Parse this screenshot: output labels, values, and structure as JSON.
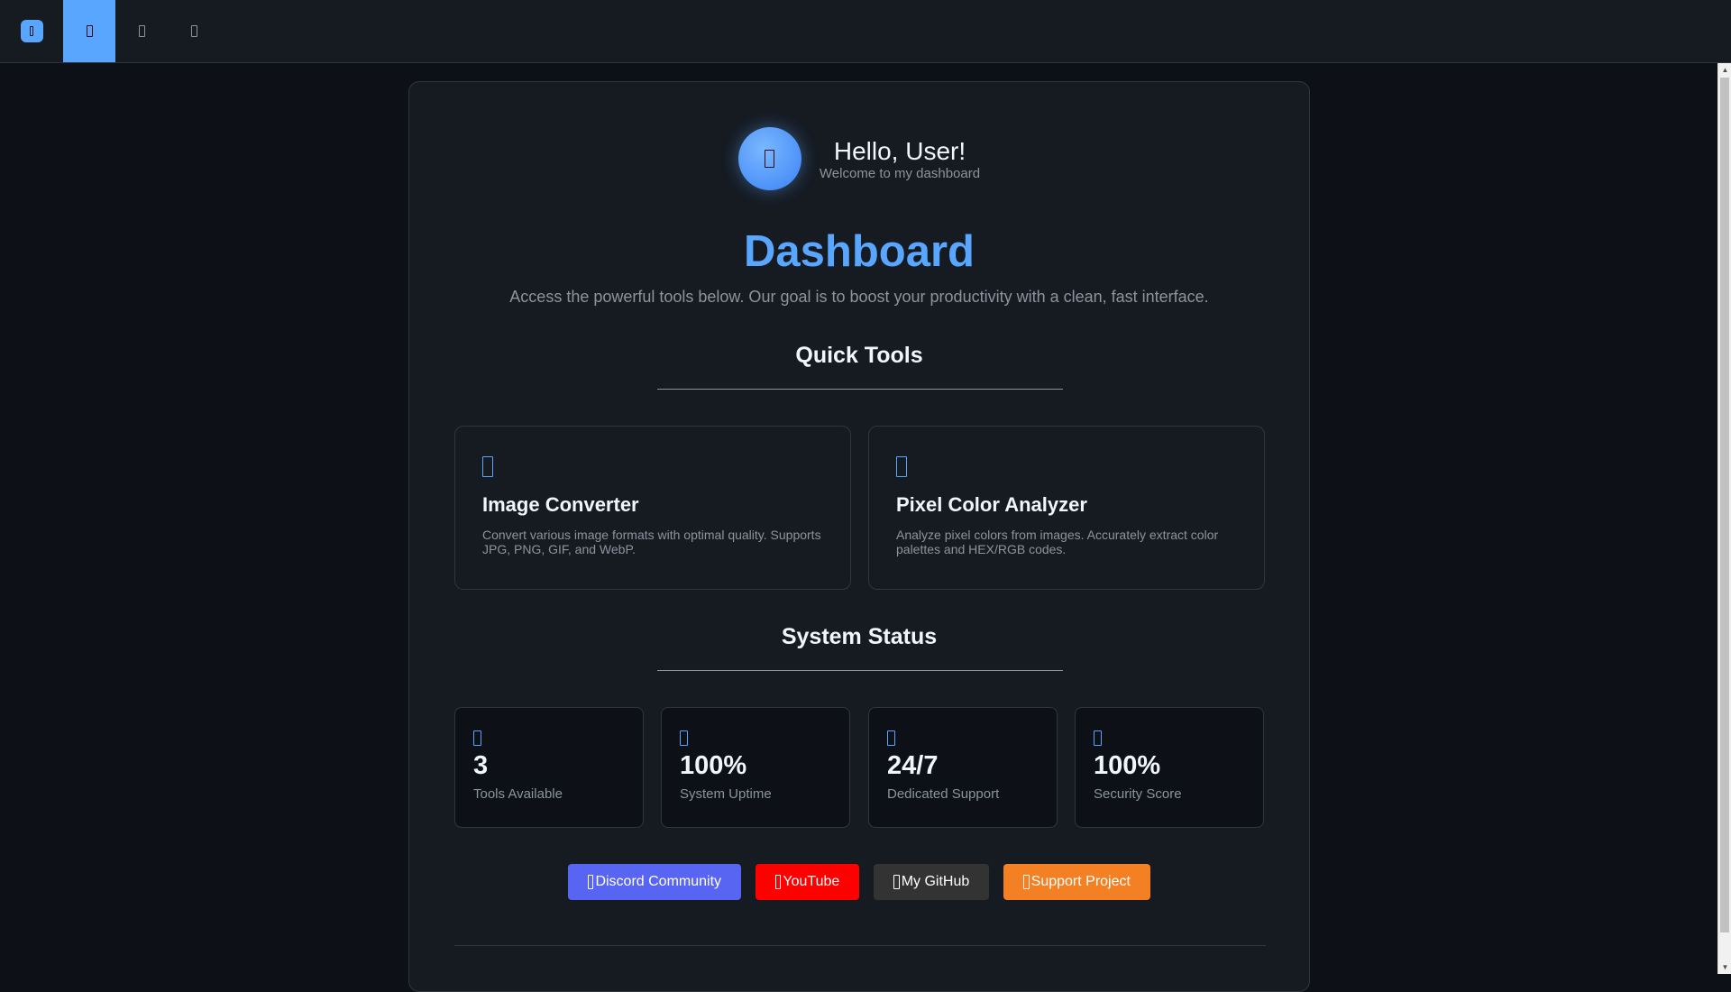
{
  "topbar": {
    "logo_icon": "app-logo-icon",
    "nav": [
      {
        "icon": "home-icon",
        "active": true
      },
      {
        "icon": "tools-icon",
        "active": false
      },
      {
        "icon": "info-icon",
        "active": false
      }
    ]
  },
  "greeting": {
    "avatar_icon": "user-icon",
    "title": "Hello, User!",
    "subtitle": "Welcome to my dashboard"
  },
  "dashboard": {
    "title": "Dashboard",
    "description": "Access the powerful tools below. Our goal is to boost your productivity with a clean, fast interface."
  },
  "quick_tools": {
    "title": "Quick Tools",
    "items": [
      {
        "icon": "image-icon",
        "title": "Image Converter",
        "description": "Convert various image formats with optimal quality. Supports JPG, PNG, GIF, and WebP."
      },
      {
        "icon": "eyedropper-icon",
        "title": "Pixel Color Analyzer",
        "description": "Analyze pixel colors from images. Accurately extract color palettes and HEX/RGB codes."
      }
    ]
  },
  "system_status": {
    "title": "System Status",
    "items": [
      {
        "icon": "toolbox-icon",
        "value": "3",
        "label": "Tools Available"
      },
      {
        "icon": "server-icon",
        "value": "100%",
        "label": "System Uptime"
      },
      {
        "icon": "headset-icon",
        "value": "24/7",
        "label": "Dedicated Support"
      },
      {
        "icon": "shield-icon",
        "value": "100%",
        "label": "Security Score"
      }
    ]
  },
  "links": [
    {
      "label": "Discord Community",
      "color": "#5865f2",
      "icon": "discord-icon"
    },
    {
      "label": "YouTube",
      "color": "#ff0000",
      "icon": "youtube-icon"
    },
    {
      "label": "My GitHub",
      "color": "#333333",
      "icon": "github-icon"
    },
    {
      "label": "Support Project",
      "color": "#f48024",
      "icon": "heart-icon"
    }
  ],
  "colors": {
    "accent": "#58a6ff",
    "background": "#0d1117",
    "card": "#161b22"
  }
}
